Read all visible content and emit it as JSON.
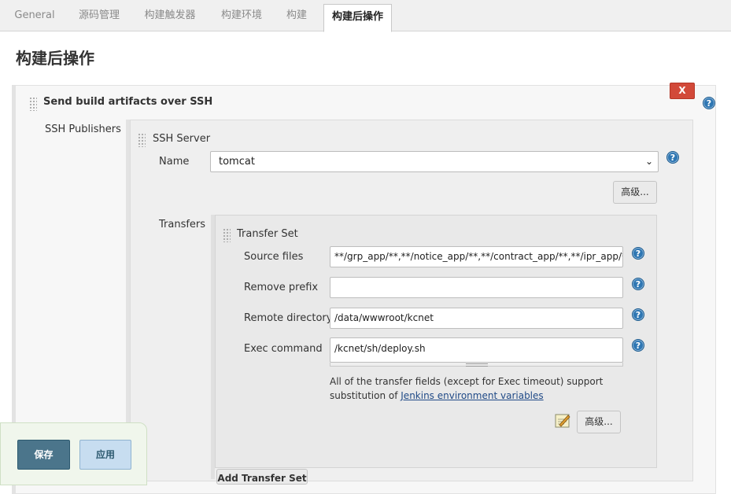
{
  "tabs": [
    {
      "label": "General"
    },
    {
      "label": "源码管理"
    },
    {
      "label": "构建触发器"
    },
    {
      "label": "构建环境"
    },
    {
      "label": "构建"
    },
    {
      "label": "构建后操作"
    }
  ],
  "page": {
    "title": "构建后操作"
  },
  "section": {
    "title": "Send build artifacts over SSH",
    "delete_label": "X",
    "publishers_label": "SSH Publishers"
  },
  "ssh_server": {
    "title": "SSH Server",
    "name_label": "Name",
    "name_value": "tomcat",
    "advanced_label": "高级...",
    "transfers_label": "Transfers"
  },
  "transfer_set": {
    "title": "Transfer Set",
    "source_files_label": "Source files",
    "source_files_value": "**/grp_app/**,**/notice_app/**,**/contract_app/**,**/ipr_app/**,**/",
    "remove_prefix_label": "Remove prefix",
    "remove_prefix_value": "",
    "remote_directory_label": "Remote directory",
    "remote_directory_value": "/data/wwwroot/kcnet",
    "exec_command_label": "Exec command",
    "exec_command_value": "/kcnet/sh/deploy.sh",
    "note_line1": "All of the transfer fields (except for Exec timeout) support",
    "note_prefix": "substitution of ",
    "note_link": "Jenkins environment variables",
    "advanced_label": "高级...",
    "add_label": "Add Transfer Set"
  },
  "help_glyph": "?",
  "footer": {
    "save_label": "保存",
    "apply_label": "应用"
  },
  "colors": {
    "save": "#4b758b",
    "apply": "#c7ddf0",
    "delete": "#d24939",
    "help": "#2f77b3"
  }
}
